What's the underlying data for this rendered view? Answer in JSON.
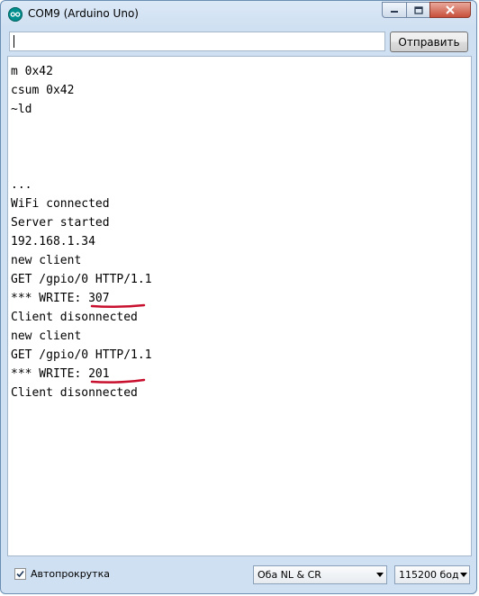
{
  "window": {
    "title": "COM9 (Arduino Uno)"
  },
  "input": {
    "value": ""
  },
  "send_button": {
    "label": "Отправить"
  },
  "console": {
    "lines": [
      "m 0x42",
      "csum 0x42",
      "~ld",
      "",
      "",
      "",
      "...",
      "WiFi connected",
      "Server started",
      "192.168.1.34",
      "new client",
      "GET /gpio/0 HTTP/1.1",
      "*** WRITE: 307",
      "Client disonnected",
      "new client",
      "GET /gpio/0 HTTP/1.1",
      "*** WRITE: 201",
      "Client disonnected"
    ]
  },
  "autoscroll": {
    "label": "Автопрокрутка",
    "checked": true
  },
  "line_ending": {
    "selected": "Оба NL & CR"
  },
  "baud_rate": {
    "selected": "115200 бод"
  },
  "colors": {
    "annotation": "#c8102e",
    "titlebar": "#cfe0f2"
  }
}
